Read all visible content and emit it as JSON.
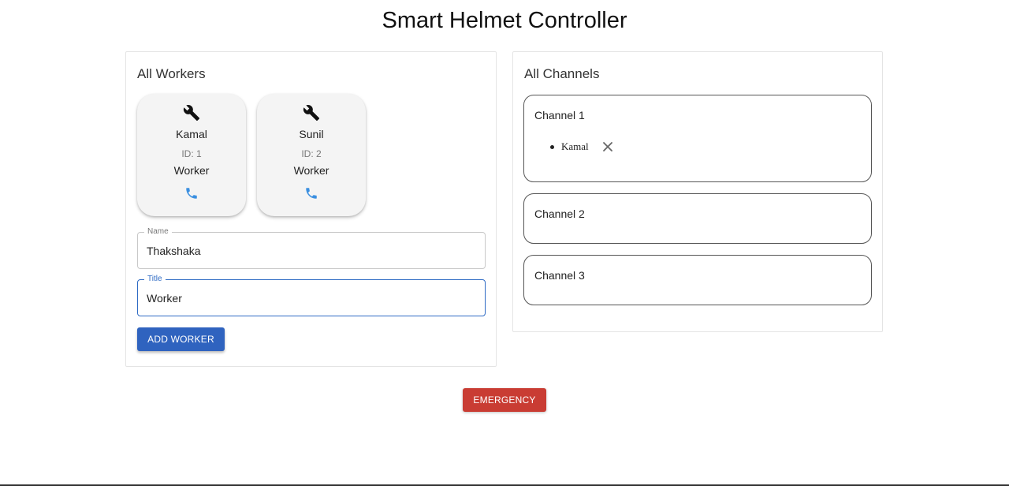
{
  "page": {
    "title": "Smart Helmet Controller"
  },
  "workers_panel": {
    "title": "All Workers",
    "workers": [
      {
        "name": "Kamal",
        "id_text": "ID: 1",
        "title": "Worker",
        "icon": "wrench-icon",
        "action_icon": "phone-icon"
      },
      {
        "name": "Sunil",
        "id_text": "ID: 2",
        "title": "Worker",
        "icon": "wrench-icon",
        "action_icon": "phone-icon"
      }
    ],
    "form": {
      "name_label": "Name",
      "name_value": "Thakshaka",
      "title_label": "Title",
      "title_value": "Worker",
      "add_button_label": "ADD WORKER"
    }
  },
  "channels_panel": {
    "title": "All Channels",
    "channels": [
      {
        "name": "Channel 1",
        "members": [
          "Kamal"
        ]
      },
      {
        "name": "Channel 2",
        "members": []
      },
      {
        "name": "Channel 3",
        "members": []
      }
    ]
  },
  "emergency_button_label": "EMERGENCY",
  "colors": {
    "primary": "#2f63bf",
    "danger": "#c93c33",
    "phone_icon": "#3a8fe0",
    "card_bg": "#f4f4f4"
  }
}
